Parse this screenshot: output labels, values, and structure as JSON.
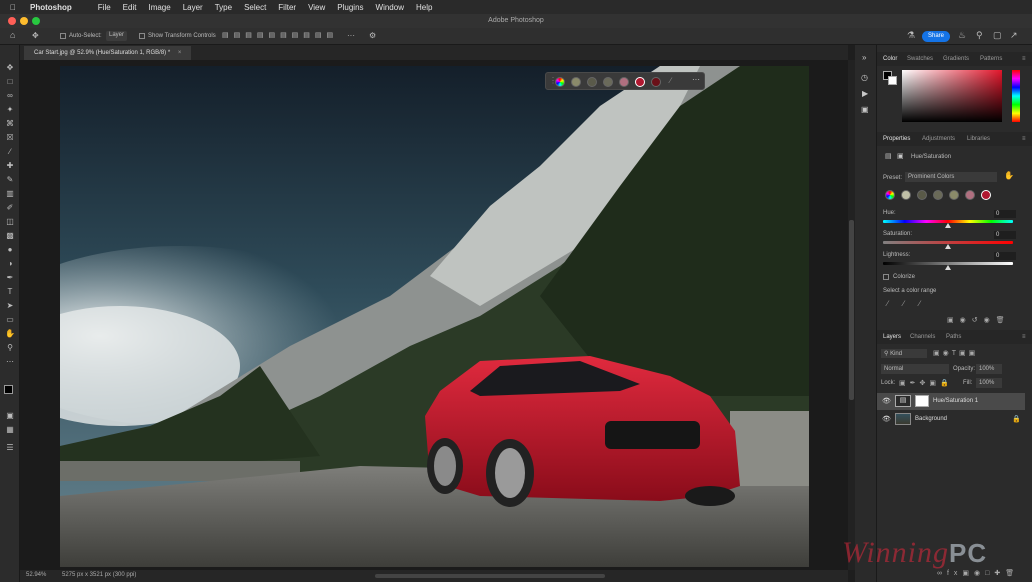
{
  "menubar": {
    "app_name": "Photoshop",
    "items": [
      "File",
      "Edit",
      "Image",
      "Layer",
      "Type",
      "Select",
      "Filter",
      "View",
      "Plugins",
      "Window",
      "Help"
    ]
  },
  "window": {
    "title": "Adobe Photoshop"
  },
  "options_bar": {
    "auto_select_label": "Auto-Select:",
    "auto_select_value": "Layer",
    "transform_label": "Show Transform Controls",
    "share_label": "Share",
    "more_label": "···"
  },
  "document": {
    "tab_title": "Car Start.jpg @ 52.9% (Hue/Saturation 1, RGB/8) *"
  },
  "context_bar": {
    "swatches": [
      "#8a8a6a",
      "#5a5a4a",
      "#6a6a5a",
      "#b07080",
      "#b01830",
      "#6a1018"
    ],
    "more_label": "···"
  },
  "status_bar": {
    "zoom": "52.94%",
    "doc_size": "5275 px x 3521 px (300 ppi)"
  },
  "color_panel": {
    "tabs": [
      "Color",
      "Swatches",
      "Gradients",
      "Patterns"
    ],
    "active_tab": "Color"
  },
  "properties_panel": {
    "tabs": [
      "Properties",
      "Adjustments",
      "Libraries"
    ],
    "active_tab": "Properties",
    "adjustment_name": "Hue/Saturation",
    "preset_label": "Preset:",
    "preset_value": "Prominent Colors",
    "swatches": [
      "#c0c0a8",
      "#5a5a48",
      "#6a6a58",
      "#8a8a6a",
      "#b07080",
      "#b01830",
      "#6a1018"
    ],
    "hue_label": "Hue:",
    "hue_value": "0",
    "hue_position": 0.5,
    "saturation_label": "Saturation:",
    "saturation_value": "0",
    "saturation_position": 0.5,
    "lightness_label": "Lightness:",
    "lightness_value": "0",
    "lightness_position": 0.5,
    "colorize_label": "Colorize",
    "select_range_label": "Select a color range"
  },
  "layers_panel": {
    "tabs": [
      "Layers",
      "Channels",
      "Paths"
    ],
    "active_tab": "Layers",
    "kind_label": "Kind",
    "blend_mode": "Normal",
    "opacity_label": "Opacity:",
    "opacity_value": "100%",
    "lock_label": "Lock:",
    "fill_label": "Fill:",
    "fill_value": "100%",
    "layers": [
      {
        "name": "Hue/Saturation 1"
      },
      {
        "name": "Background"
      }
    ]
  },
  "watermark": {
    "part1": "Winning",
    "part2": "PC"
  },
  "colors": {
    "accent": "#1473e6",
    "background": "#1e1e1e",
    "panel": "#2b2b2b"
  }
}
